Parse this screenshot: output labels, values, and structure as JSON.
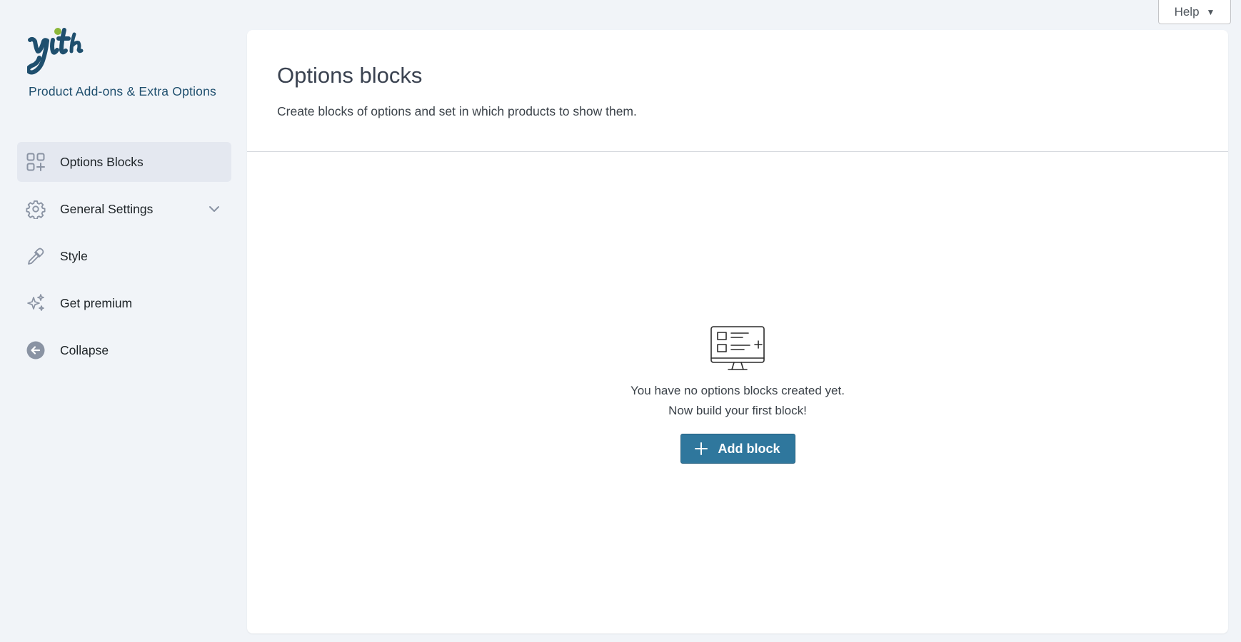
{
  "help": {
    "label": "Help",
    "arrow": "▼"
  },
  "sidebar": {
    "logo_icon": "yith-logo-icon",
    "plugin_title": "Product Add-ons & Extra Options",
    "items": [
      {
        "label": "Options Blocks",
        "icon": "blocks-grid-icon",
        "active": true
      },
      {
        "label": "General Settings",
        "icon": "gear-icon",
        "has_submenu": true
      },
      {
        "label": "Style",
        "icon": "eyedropper-icon"
      },
      {
        "label": "Get premium",
        "icon": "sparkles-icon"
      },
      {
        "label": "Collapse",
        "icon": "arrow-left-circle-icon"
      }
    ]
  },
  "main": {
    "title": "Options blocks",
    "subtitle": "Create blocks of options and set in which products to show them.",
    "empty_state": {
      "icon": "monitor-list-icon",
      "line1": "You have no options blocks created yet.",
      "line2": "Now build your first block!",
      "button_label": "Add block"
    }
  },
  "colors": {
    "accent": "#2f779d",
    "background": "#f1f4f8",
    "active_nav": "#e4e8f0",
    "logo_dot": "#8cb73a",
    "logo_text": "#1f4f6e"
  }
}
